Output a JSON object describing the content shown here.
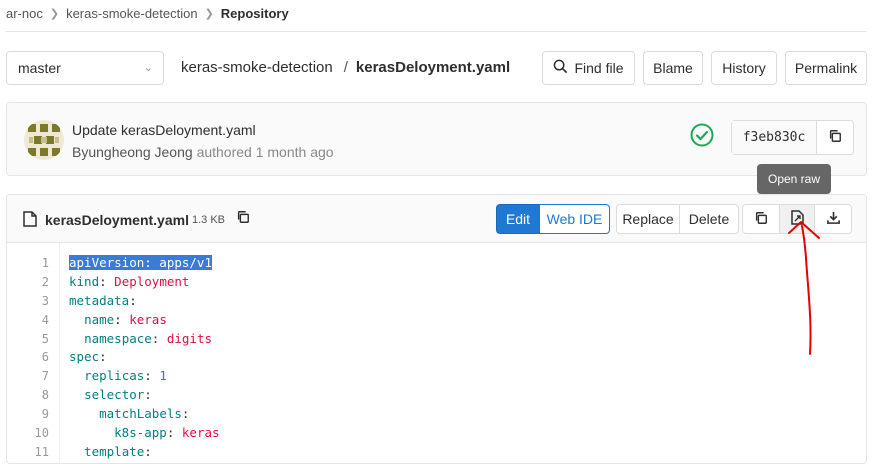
{
  "breadcrumb": [
    "ar-noc",
    "keras-smoke-detection",
    "Repository"
  ],
  "branch": {
    "selected": "master"
  },
  "path": {
    "repo": "keras-smoke-detection",
    "separator": "/",
    "file": "kerasDeloyment.yaml"
  },
  "actions": {
    "find_file": "Find file",
    "blame": "Blame",
    "history": "History",
    "permalink": "Permalink"
  },
  "commit": {
    "title": "Update kerasDeloyment.yaml",
    "author": "Byungheong Jeong",
    "authored_text": "authored 1 month ago",
    "sha": "f3eb830c",
    "status": "passed"
  },
  "file": {
    "name": "kerasDeloyment.yaml",
    "size": "1.3 KB",
    "edit": "Edit",
    "web_ide": "Web IDE",
    "replace": "Replace",
    "delete": "Delete"
  },
  "tooltip": "Open raw",
  "code": {
    "line_numbers": [
      "1",
      "2",
      "3",
      "4",
      "5",
      "6",
      "7",
      "8",
      "9",
      "10",
      "11"
    ],
    "lines": [
      "apiVersion: apps/v1",
      "kind: Deployment",
      "metadata:",
      "  name: keras",
      "  namespace: digits",
      "spec:",
      "  replicas: 1",
      "  selector:",
      "    matchLabels:",
      "      k8s-app: keras",
      "  template:"
    ]
  },
  "colors": {
    "primary": "#1f78d1",
    "success": "#1aaa55",
    "annotation": "#e60000"
  }
}
